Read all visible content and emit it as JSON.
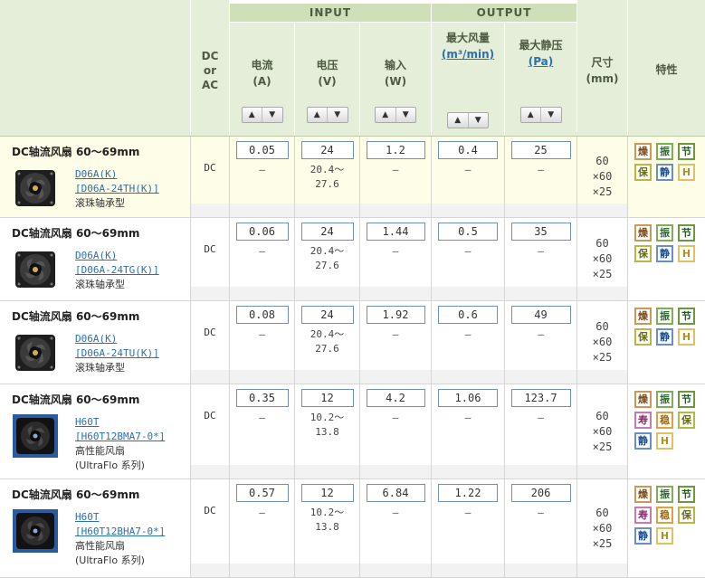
{
  "header": {
    "dc_or_ac": [
      "DC",
      "or",
      "AC"
    ],
    "input_group": "INPUT",
    "output_group": "OUTPUT",
    "columns": [
      {
        "l1": "电流",
        "l2": "(A)"
      },
      {
        "l1": "电压",
        "l2": "(V)"
      },
      {
        "l1": "输入",
        "l2": "(W)"
      },
      {
        "l1": "最大风量",
        "l2": "(m³/min)"
      },
      {
        "l1": "最大静压",
        "l2": "(Pa)"
      }
    ],
    "size_label": {
      "l1": "尺寸",
      "l2": "(mm)"
    },
    "feature_label": "特性",
    "sort_up": "▲",
    "sort_down": "▼"
  },
  "products": [
    {
      "title": "DC轴流风扇  60～69mm",
      "link1": "D06A(K)",
      "link2": "[D06A-24TH(K)]",
      "type": "滚珠轴承型",
      "type2": "",
      "dc": "DC",
      "current": "0.05",
      "current_sub": "–",
      "voltage": "24",
      "voltage_sub": [
        "20.4～",
        "27.6"
      ],
      "input": "1.2",
      "input_sub": "–",
      "airflow": "0.4",
      "airflow_sub": "–",
      "pressure": "25",
      "pressure_sub": "–",
      "size": [
        "60",
        "×60",
        "×25"
      ],
      "features": [
        "燥",
        "振",
        "节",
        "保",
        "静",
        "H"
      ]
    },
    {
      "title": "DC轴流风扇  60～69mm",
      "link1": "D06A(K)",
      "link2": "[D06A-24TG(K)]",
      "type": "滚珠轴承型",
      "type2": "",
      "dc": "DC",
      "current": "0.06",
      "current_sub": "–",
      "voltage": "24",
      "voltage_sub": [
        "20.4～",
        "27.6"
      ],
      "input": "1.44",
      "input_sub": "–",
      "airflow": "0.5",
      "airflow_sub": "–",
      "pressure": "35",
      "pressure_sub": "–",
      "size": [
        "60",
        "×60",
        "×25"
      ],
      "features": [
        "燥",
        "振",
        "节",
        "保",
        "静",
        "H"
      ]
    },
    {
      "title": "DC轴流风扇  60～69mm",
      "link1": "D06A(K)",
      "link2": "[D06A-24TU(K)]",
      "type": "滚珠轴承型",
      "type2": "",
      "dc": "DC",
      "current": "0.08",
      "current_sub": "–",
      "voltage": "24",
      "voltage_sub": [
        "20.4～",
        "27.6"
      ],
      "input": "1.92",
      "input_sub": "–",
      "airflow": "0.6",
      "airflow_sub": "–",
      "pressure": "49",
      "pressure_sub": "–",
      "size": [
        "60",
        "×60",
        "×25"
      ],
      "features": [
        "燥",
        "振",
        "节",
        "保",
        "静",
        "H"
      ]
    },
    {
      "title": "DC轴流风扇  60～69mm",
      "link1": "H60T",
      "link2": "[H60T12BMA7-0*]",
      "type": "高性能风扇",
      "type2": "(UltraFlo 系列)",
      "dc": "DC",
      "current": "0.35",
      "current_sub": "–",
      "voltage": "12",
      "voltage_sub": [
        "10.2～",
        "13.8"
      ],
      "input": "4.2",
      "input_sub": "–",
      "airflow": "1.06",
      "airflow_sub": "–",
      "pressure": "123.7",
      "pressure_sub": "–",
      "size": [
        "60",
        "×60",
        "×25"
      ],
      "features": [
        "燥",
        "振",
        "节",
        "寿",
        "稳",
        "保",
        "静",
        "H"
      ]
    },
    {
      "title": "DC轴流风扇  60～69mm",
      "link1": "H60T",
      "link2": "[H60T12BHA7-0*]",
      "type": "高性能风扇",
      "type2": "(UltraFlo 系列)",
      "dc": "DC",
      "current": "0.57",
      "current_sub": "–",
      "voltage": "12",
      "voltage_sub": [
        "10.2～",
        "13.8"
      ],
      "input": "6.84",
      "input_sub": "–",
      "airflow": "1.22",
      "airflow_sub": "–",
      "pressure": "206",
      "pressure_sub": "–",
      "size": [
        "60",
        "×60",
        "×25"
      ],
      "features": [
        "燥",
        "振",
        "节",
        "寿",
        "稳",
        "保",
        "静",
        "H"
      ]
    }
  ],
  "colors": {
    "header_bg": "#e4eed8",
    "group_bg": "#cfe0b8",
    "highlight_row": "#fefde8",
    "link": "#2a6fb0",
    "value_border": "#6d8fb8"
  }
}
